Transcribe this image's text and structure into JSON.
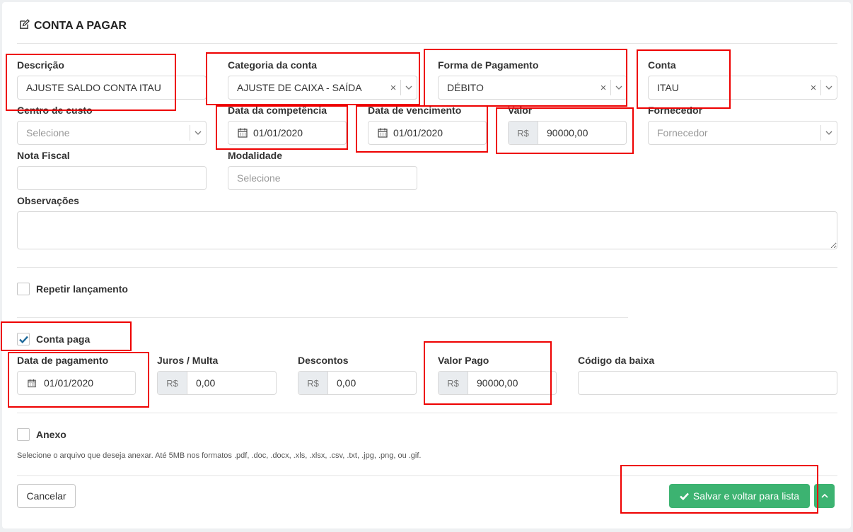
{
  "page": {
    "title": "CONTA A PAGAR",
    "title_icon": "edit-icon"
  },
  "form": {
    "descricao": {
      "label": "Descrição",
      "value": "AJUSTE SALDO CONTA ITAU"
    },
    "categoria": {
      "label": "Categoria da conta",
      "value": "AJUSTE DE CAIXA - SAÍDA"
    },
    "forma_pagamento": {
      "label": "Forma de Pagamento",
      "value": "DÉBITO"
    },
    "conta": {
      "label": "Conta",
      "value": "ITAU"
    },
    "centro_custo": {
      "label": "Centro de custo",
      "placeholder": "Selecione"
    },
    "data_competencia": {
      "label": "Data da competência",
      "value": "01/01/2020"
    },
    "data_vencimento": {
      "label": "Data de vencimento",
      "value": "01/01/2020"
    },
    "valor": {
      "label": "Valor",
      "prefix": "R$",
      "value": "90000,00"
    },
    "fornecedor": {
      "label": "Fornecedor",
      "placeholder": "Fornecedor"
    },
    "nota_fiscal": {
      "label": "Nota Fiscal",
      "value": ""
    },
    "modalidade": {
      "label": "Modalidade",
      "placeholder": "Selecione"
    },
    "observacoes": {
      "label": "Observações",
      "value": ""
    }
  },
  "repetir": {
    "label": "Repetir lançamento",
    "checked": false
  },
  "conta_paga": {
    "label": "Conta paga",
    "checked": true
  },
  "pagamento": {
    "data_pagamento": {
      "label": "Data de pagamento",
      "value": "01/01/2020"
    },
    "juros": {
      "label": "Juros / Multa",
      "prefix": "R$",
      "value": "0,00"
    },
    "descontos": {
      "label": "Descontos",
      "prefix": "R$",
      "value": "0,00"
    },
    "valor_pago": {
      "label": "Valor Pago",
      "prefix": "R$",
      "value": "90000,00"
    },
    "codigo_baixa": {
      "label": "Código da baixa",
      "value": ""
    }
  },
  "anexo": {
    "label": "Anexo",
    "checked": false,
    "help": "Selecione o arquivo que deseja anexar. Até 5MB nos formatos .pdf, .doc, .docx, .xls, .xlsx, .csv, .txt, .jpg, .png, ou .gif."
  },
  "actions": {
    "cancel": "Cancelar",
    "save": "Salvar e voltar para lista"
  },
  "colors": {
    "primary_green": "#3cb371",
    "check_blue": "#1f6a9a",
    "highlight_red": "#e00000"
  }
}
